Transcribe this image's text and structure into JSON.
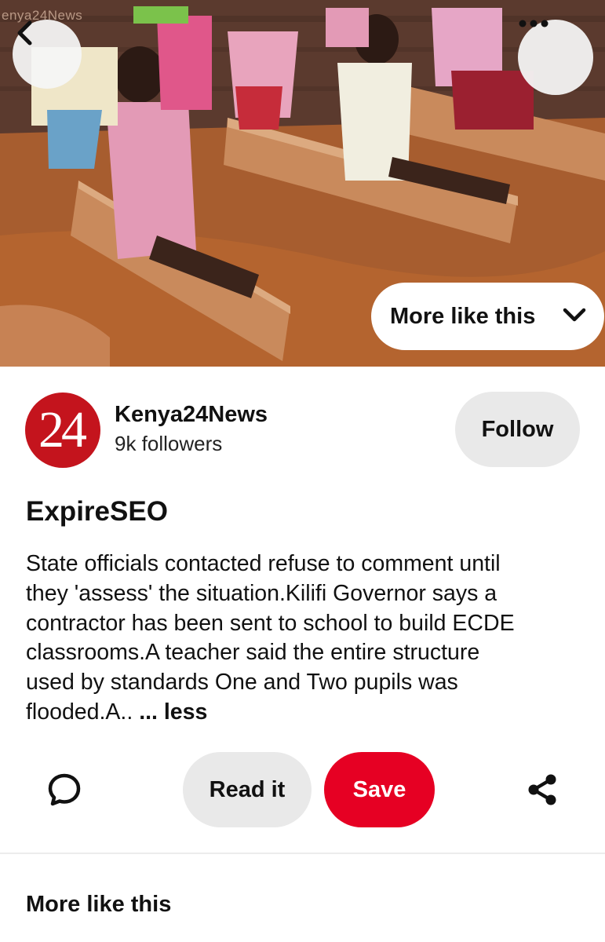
{
  "hero": {
    "watermark": "enya24News",
    "image_description_icon": "photo-of-classroom"
  },
  "top_controls": {
    "back_icon": "chevron-left-icon",
    "more_icon": "ellipsis-icon"
  },
  "more_like_this_pill": {
    "label": "More like this",
    "icon": "chevron-down-icon"
  },
  "creator": {
    "avatar_text": "24",
    "name": "Kenya24News",
    "followers": "9k followers",
    "follow_label": "Follow"
  },
  "pin": {
    "title": "ExpireSEO",
    "description_lines": [
      "State officials contacted refuse to comment until",
      "they 'assess' the situation.Kilifi Governor says a",
      "contractor has been sent to school to build ECDE",
      "classrooms.A teacher said the entire structure",
      "used by standards One and Two pupils was",
      "flooded.A.. "
    ],
    "less_label": "... less"
  },
  "actions": {
    "comment_icon": "comment-bubble-icon",
    "read_label": "Read it",
    "save_label": "Save",
    "share_icon": "share-icon"
  },
  "section": {
    "more_like_this": "More like this"
  },
  "colors": {
    "save_red": "#e60023",
    "pill_gray": "#e9e9e9",
    "avatar_red": "#c4141d"
  }
}
